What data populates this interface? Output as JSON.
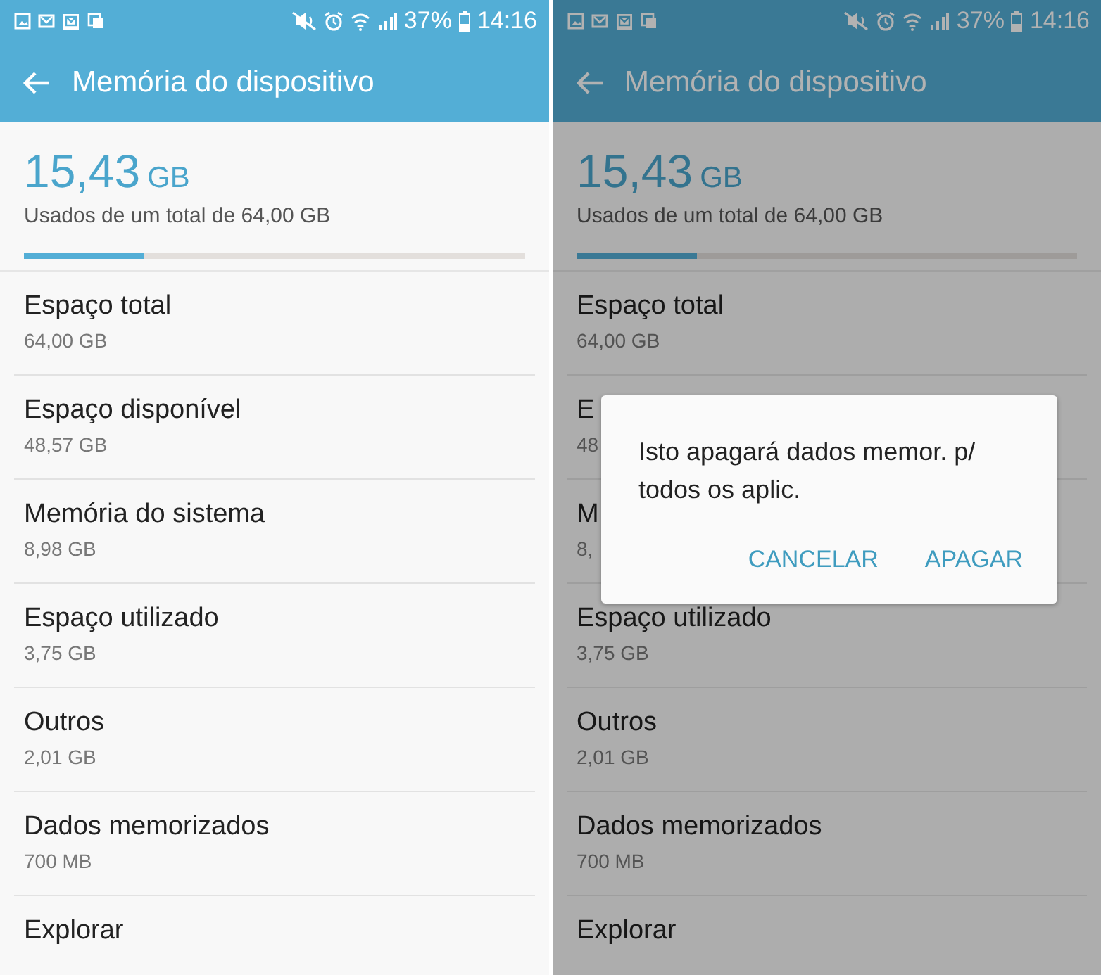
{
  "screens": [
    {
      "status_bar": {
        "battery": "37%",
        "time": "14:16"
      },
      "title": "Memória do dispositivo",
      "summary": {
        "used": "15,43",
        "unit": "GB",
        "caption": "Usados de um total de 64,00 GB",
        "level": 0.24
      },
      "items": [
        {
          "title": "Espaço total",
          "value": "64,00 GB"
        },
        {
          "title": "Espaço disponível",
          "value": "48,57 GB"
        },
        {
          "title": "Memória do sistema",
          "value": "8,98 GB"
        },
        {
          "title": "Espaço utilizado",
          "value": "3,75 GB"
        },
        {
          "title": "Outros",
          "value": "2,01 GB"
        },
        {
          "title": "Dados memorizados",
          "value": "700 MB"
        },
        {
          "title": "Explorar"
        }
      ]
    },
    {
      "dimmed": true,
      "status_bar": {
        "battery": "37%",
        "time": "14:16"
      },
      "title": "Memória do dispositivo",
      "summary": {
        "used": "15,43",
        "unit": "GB",
        "caption": "Usados de um total de 64,00 GB",
        "level": 0.24
      },
      "items": [
        {
          "title": "Espaço total",
          "value": "64,00 GB"
        },
        {
          "title": "E",
          "value": "48"
        },
        {
          "title": "M",
          "value": "8,"
        },
        {
          "title": "Espaço utilizado",
          "value": "3,75 GB"
        },
        {
          "title": "Outros",
          "value": "2,01 GB"
        },
        {
          "title": "Dados memorizados",
          "value": "700 MB"
        },
        {
          "title": "Explorar"
        }
      ],
      "dialog": {
        "message": "Isto apagará dados memor. p/ todos os aplic.",
        "buttons": [
          "CANCELAR",
          "APAGAR"
        ]
      }
    }
  ]
}
